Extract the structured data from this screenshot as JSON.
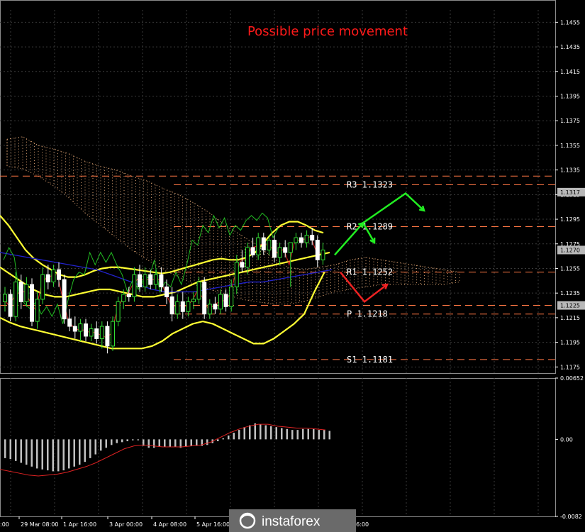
{
  "title": "Possible price movement",
  "watermark": "instaforex",
  "colors": {
    "background": "#000000",
    "grid": "#3a3a3a",
    "axis_text": "#ffffff",
    "bull_candle": "#33dd33",
    "bear_candle": "#ffffff",
    "bollinger": "#ffff33",
    "kijun": "#2222cc",
    "tenkan": "#dd2222",
    "chikou": "#22bb22",
    "cloud": "#d9a070",
    "level_line": "#ff7744",
    "label_bg": "#b8b8b8",
    "arrow_up": "#22ee22",
    "arrow_down": "#ee2222",
    "title": "#ff1a1a",
    "macd_hist": "#c0c0c0",
    "macd_signal": "#dd2222"
  },
  "chart_data": [
    {
      "type": "candlestick",
      "title": "Possible price movement",
      "ylim": [
        1.117,
        1.1465
      ],
      "y_ticks": [
        "1.1455",
        "1.1435",
        "1.1415",
        "1.1395",
        "1.1375",
        "1.1355",
        "1.1335",
        "1.1315",
        "1.1295",
        "1.1275",
        "1.1255",
        "1.1235",
        "1.1215",
        "1.1195",
        "1.1175"
      ],
      "x_ticks": [
        "29 Mar 08:00",
        "1 Apr 16:00",
        "3 Apr 00:00",
        "4 Apr 08:00",
        "5 Apr 16:00",
        "16:00"
      ],
      "price_labels": [
        {
          "text": "1.1317",
          "value": 1.1317
        },
        {
          "text": "1.1270",
          "value": 1.127
        },
        {
          "text": "1.1225",
          "value": 1.1225
        }
      ],
      "levels": [
        {
          "label": "R3",
          "text": "R3  1.1323",
          "value": 1.1323
        },
        {
          "label": "R2",
          "text": "R2  1.1289",
          "value": 1.1289
        },
        {
          "label": "R1",
          "text": "R1  1.1252",
          "value": 1.1252
        },
        {
          "label": "P",
          "text": "P  1.1218",
          "value": 1.1218
        },
        {
          "label": "S1",
          "text": "S1  1.1181",
          "value": 1.1181
        }
      ],
      "extra_lines": [
        1.133,
        1.1225
      ],
      "candles": [
        [
          1.1228,
          1.124,
          1.122,
          1.1234
        ],
        [
          1.1234,
          1.1238,
          1.1212,
          1.1216
        ],
        [
          1.1216,
          1.1252,
          1.1212,
          1.1244
        ],
        [
          1.1244,
          1.125,
          1.1222,
          1.1228
        ],
        [
          1.1228,
          1.1248,
          1.1224,
          1.1242
        ],
        [
          1.1242,
          1.1247,
          1.1208,
          1.1212
        ],
        [
          1.1212,
          1.1236,
          1.1206,
          1.123
        ],
        [
          1.123,
          1.1256,
          1.1226,
          1.125
        ],
        [
          1.125,
          1.1258,
          1.1238,
          1.1244
        ],
        [
          1.1244,
          1.1258,
          1.124,
          1.1254
        ],
        [
          1.1254,
          1.126,
          1.124,
          1.1246
        ],
        [
          1.1246,
          1.125,
          1.121,
          1.1214
        ],
        [
          1.1214,
          1.1222,
          1.1204,
          1.1208
        ],
        [
          1.1208,
          1.1216,
          1.1198,
          1.1204
        ],
        [
          1.1204,
          1.1214,
          1.1196,
          1.121
        ],
        [
          1.121,
          1.1214,
          1.1196,
          1.12
        ],
        [
          1.12,
          1.121,
          1.1196,
          1.1206
        ],
        [
          1.1206,
          1.1212,
          1.1194,
          1.1198
        ],
        [
          1.1198,
          1.1212,
          1.119,
          1.1208
        ],
        [
          1.1208,
          1.1212,
          1.1186,
          1.1192
        ],
        [
          1.1192,
          1.1216,
          1.1188,
          1.1212
        ],
        [
          1.1212,
          1.1232,
          1.1208,
          1.1228
        ],
        [
          1.1228,
          1.1238,
          1.1222,
          1.1234
        ],
        [
          1.1234,
          1.124,
          1.1228,
          1.1232
        ],
        [
          1.1232,
          1.1256,
          1.1228,
          1.125
        ],
        [
          1.125,
          1.1258,
          1.1236,
          1.124
        ],
        [
          1.124,
          1.1256,
          1.1236,
          1.125
        ],
        [
          1.125,
          1.1254,
          1.1238,
          1.1242
        ],
        [
          1.1242,
          1.1254,
          1.1238,
          1.125
        ],
        [
          1.125,
          1.1256,
          1.1236,
          1.124
        ],
        [
          1.124,
          1.1246,
          1.1226,
          1.1232
        ],
        [
          1.1232,
          1.124,
          1.1212,
          1.1218
        ],
        [
          1.1218,
          1.1234,
          1.1214,
          1.1228
        ],
        [
          1.1228,
          1.1236,
          1.1214,
          1.122
        ],
        [
          1.122,
          1.1232,
          1.1216,
          1.1228
        ],
        [
          1.1228,
          1.1236,
          1.1222,
          1.123
        ],
        [
          1.123,
          1.1248,
          1.1226,
          1.1244
        ],
        [
          1.1244,
          1.1248,
          1.1214,
          1.1218
        ],
        [
          1.1218,
          1.123,
          1.1214,
          1.1226
        ],
        [
          1.1226,
          1.1232,
          1.1218,
          1.1222
        ],
        [
          1.1222,
          1.1238,
          1.1218,
          1.1234
        ],
        [
          1.1234,
          1.1238,
          1.122,
          1.1224
        ],
        [
          1.1224,
          1.1246,
          1.122,
          1.124
        ],
        [
          1.124,
          1.1266,
          1.1234,
          1.126
        ],
        [
          1.126,
          1.127,
          1.1252,
          1.1256
        ],
        [
          1.1256,
          1.1276,
          1.125,
          1.1272
        ],
        [
          1.1272,
          1.128,
          1.1264,
          1.1266
        ],
        [
          1.1266,
          1.1284,
          1.1262,
          1.128
        ],
        [
          1.128,
          1.1284,
          1.1266,
          1.127
        ],
        [
          1.127,
          1.1282,
          1.1266,
          1.1278
        ],
        [
          1.1278,
          1.1282,
          1.126,
          1.1264
        ],
        [
          1.1264,
          1.1276,
          1.1258,
          1.1272
        ],
        [
          1.1272,
          1.1278,
          1.1264,
          1.1268
        ],
        [
          1.1268,
          1.1276,
          1.124,
          1.1276
        ],
        [
          1.1276,
          1.1284,
          1.127,
          1.128
        ],
        [
          1.128,
          1.1284,
          1.1272,
          1.1276
        ],
        [
          1.1276,
          1.1286,
          1.1272,
          1.1282
        ],
        [
          1.1282,
          1.1288,
          1.1274,
          1.1278
        ],
        [
          1.1278,
          1.1282,
          1.1256,
          1.1262
        ],
        [
          1.1262,
          1.1276,
          1.1258,
          1.127
        ]
      ],
      "bollinger_upper": [
        1.1298,
        1.129,
        1.128,
        1.127,
        1.1263,
        1.1258,
        1.1254,
        1.125,
        1.1248,
        1.1248,
        1.125,
        1.1253,
        1.1255,
        1.1256,
        1.1256,
        1.1255,
        1.1254,
        1.1253,
        1.1252,
        1.1251,
        1.1252,
        1.1254,
        1.1256,
        1.1258,
        1.126,
        1.1262,
        1.1263,
        1.1262,
        1.1262,
        1.1264,
        1.1268,
        1.1276,
        1.1284,
        1.129,
        1.1293,
        1.1293,
        1.129,
        1.1286,
        1.1284
      ],
      "bollinger_middle": [
        1.1256,
        1.125,
        1.1244,
        1.1238,
        1.1234,
        1.1232,
        1.1232,
        1.1234,
        1.1236,
        1.1238,
        1.1238,
        1.1236,
        1.1234,
        1.1232,
        1.1232,
        1.1234,
        1.1236,
        1.124,
        1.1244,
        1.1246,
        1.1248,
        1.125,
        1.1252,
        1.1254,
        1.1256,
        1.1258,
        1.126,
        1.1262,
        1.1264,
        1.1266,
        1.1268
      ],
      "bollinger_lower": [
        1.1215,
        1.1211,
        1.1208,
        1.1206,
        1.1204,
        1.1202,
        1.12,
        1.1198,
        1.1196,
        1.1194,
        1.1192,
        1.119,
        1.119,
        1.119,
        1.119,
        1.1192,
        1.1196,
        1.1202,
        1.1206,
        1.121,
        1.1212,
        1.121,
        1.1206,
        1.1202,
        1.1198,
        1.1194,
        1.1194,
        1.1198,
        1.1204,
        1.121,
        1.1218,
        1.1236,
        1.1252
      ],
      "kijun": [
        1.1268,
        1.1266,
        1.1264,
        1.1262,
        1.126,
        1.1258,
        1.1256,
        1.1254,
        1.125,
        1.1246,
        1.1242,
        1.1238,
        1.1236,
        1.1236,
        1.1236,
        1.1238,
        1.124,
        1.1242,
        1.1244,
        1.1244,
        1.1246,
        1.1248,
        1.125,
        1.1252,
        1.1254
      ],
      "projection_up": [
        [
          1.1266,
          1.1292
        ],
        [
          1.1289,
          1.1276
        ],
        [
          1.1276,
          1.1316
        ],
        [
          1.1316,
          1.1302
        ]
      ],
      "projection_down": [
        [
          1.1252,
          1.1228
        ],
        [
          1.1228,
          1.1242
        ]
      ]
    },
    {
      "type": "bar",
      "title": "",
      "ylim": [
        -0.0082,
        0.00652
      ],
      "y_ticks": [
        "0.00652",
        "0.00",
        "-0.0082"
      ],
      "histogram": [
        -0.002,
        -0.0021,
        -0.0023,
        -0.0025,
        -0.0027,
        -0.0029,
        -0.0031,
        -0.0032,
        -0.0033,
        -0.0034,
        -0.0034,
        -0.0033,
        -0.0031,
        -0.0029,
        -0.0027,
        -0.0024,
        -0.002,
        -0.0016,
        -0.0012,
        -0.0009,
        -0.0006,
        -0.0004,
        -0.0003,
        -0.0002,
        -0.0001,
        -0.0001,
        -0.0007,
        -0.0009,
        -0.0009,
        -0.0008,
        -0.0008,
        -0.0008,
        -0.0008,
        -0.0009,
        -0.0008,
        -0.0007,
        -0.0007,
        -0.0007,
        -0.0006,
        -0.0004,
        -0.0002,
        0.0001,
        0.0004,
        0.0007,
        0.001,
        0.0013,
        0.0015,
        0.0017,
        0.0016,
        0.0015,
        0.0014,
        0.0013,
        0.0012,
        0.0011,
        0.001,
        0.001,
        0.0011,
        0.0011,
        0.0011,
        0.001,
        0.001,
        0.0009
      ],
      "signal": [
        -0.0032,
        -0.0034,
        -0.0036,
        -0.0038,
        -0.0039,
        -0.0038,
        -0.0037,
        -0.0035,
        -0.0032,
        -0.0029,
        -0.0025,
        -0.002,
        -0.0015,
        -0.001,
        -0.0007,
        -0.0006,
        -0.0007,
        -0.0008,
        -0.0008,
        -0.0008,
        -0.0007,
        -0.0006,
        -0.0003,
        0.0002,
        0.0007,
        0.0011,
        0.0014,
        0.0016,
        0.0016,
        0.0014,
        0.0013,
        0.0012,
        0.0012,
        0.0011,
        0.001
      ]
    }
  ]
}
